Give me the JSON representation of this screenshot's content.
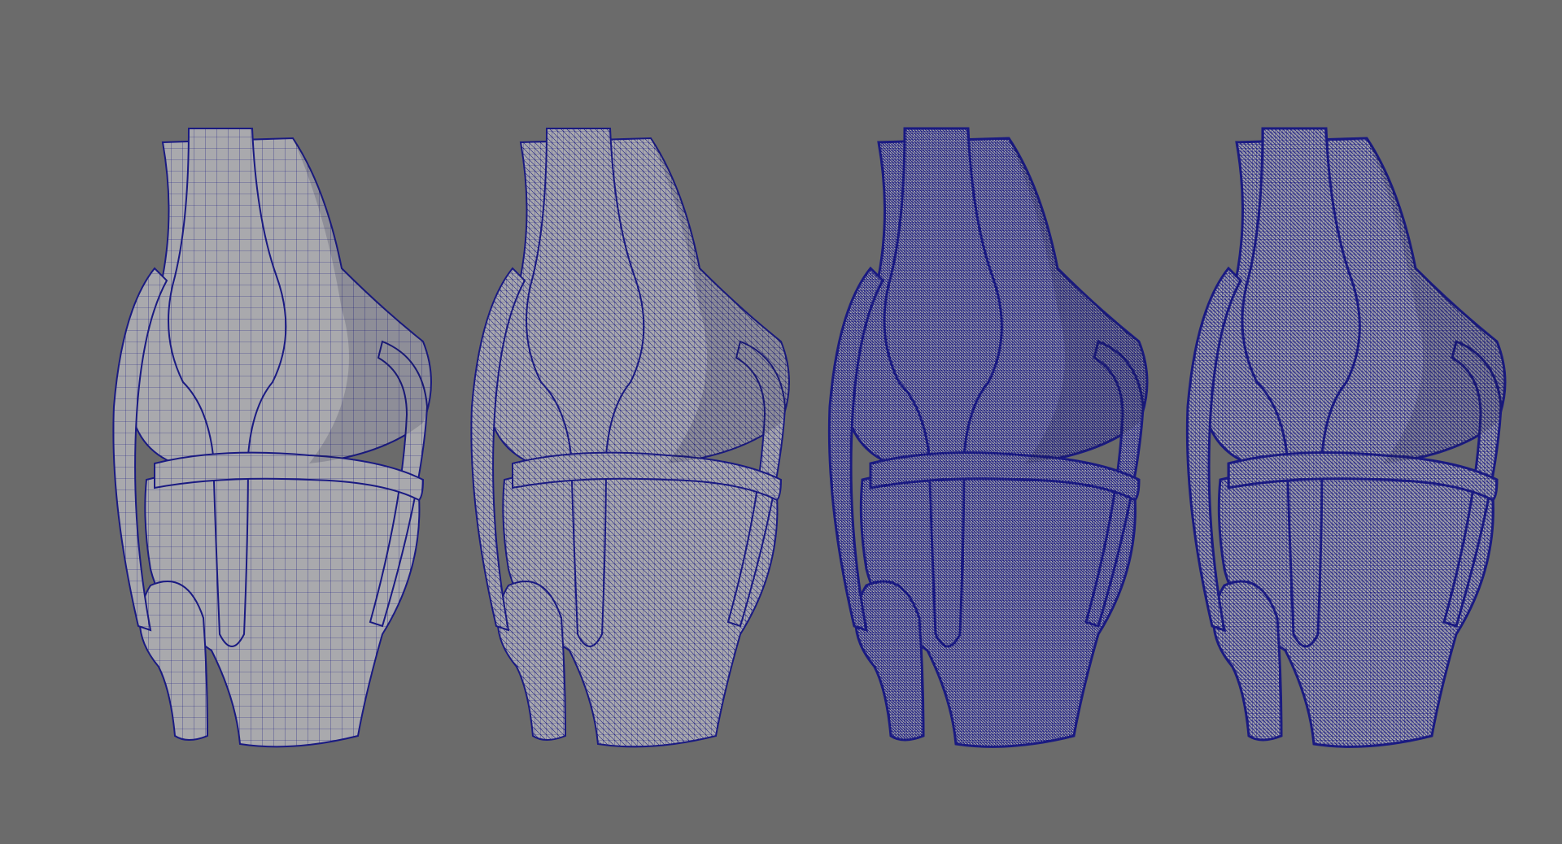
{
  "scene": {
    "background_color": "#6b6b6b",
    "shade_color": "#a9a9ad",
    "wire_color": "#1a1a82",
    "models": [
      {
        "id": "knee-quad-mesh",
        "mesh_density": 1
      },
      {
        "id": "knee-triangulated-mesh",
        "mesh_density": 2
      },
      {
        "id": "knee-dense-mesh-a",
        "mesh_density": 4
      },
      {
        "id": "knee-dense-mesh-b",
        "mesh_density": 3
      }
    ]
  }
}
